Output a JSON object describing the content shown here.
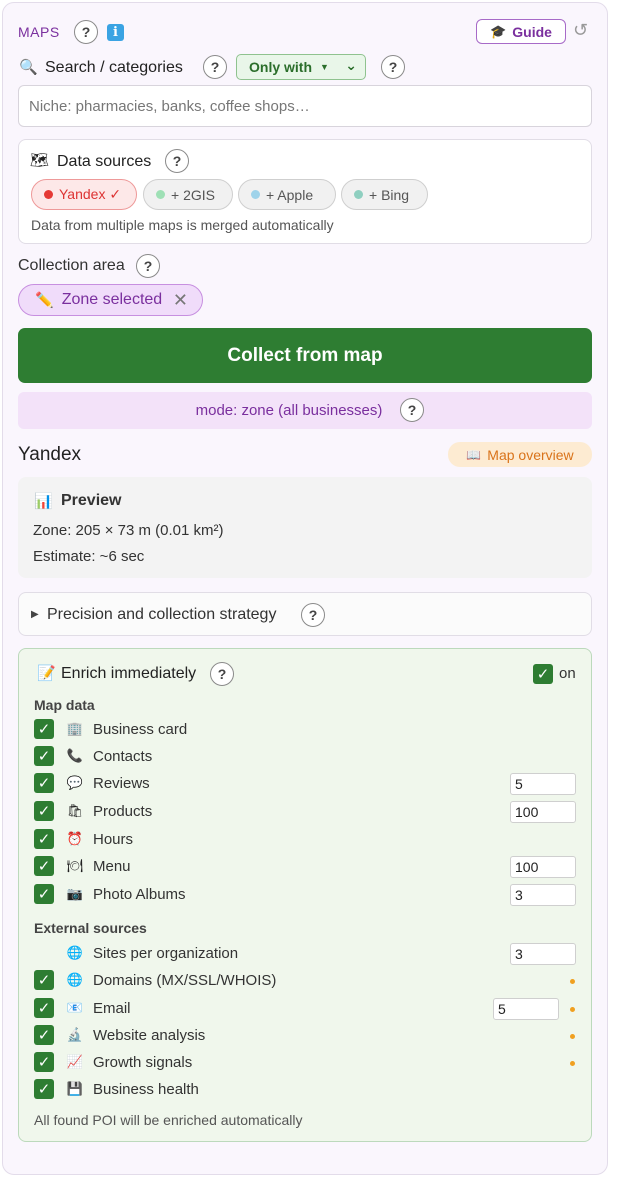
{
  "header": {
    "title": "MAPS",
    "info_glyph": "i",
    "guide_label": "Guide",
    "reset_glyph": "↺"
  },
  "search": {
    "label": "Search / categories",
    "filter_value": "Only with",
    "placeholder": "Niche: pharmacies, banks, coffee shops…"
  },
  "sources": {
    "title": "Data sources",
    "items": [
      {
        "label": "Yandex ✓",
        "color": "#e53935",
        "active": true
      },
      {
        "label": "+ 2GIS",
        "color": "#9ee0b5",
        "active": false
      },
      {
        "label": "+ Apple",
        "color": "#9fd3ea",
        "active": false
      },
      {
        "label": "+ Bing",
        "color": "#8fcfc0",
        "active": false
      }
    ],
    "note": "Data from multiple maps is merged automatically"
  },
  "area": {
    "label": "Collection area",
    "chip": "Zone selected"
  },
  "collect_button": "Collect from map",
  "mode_text": "mode: zone (all businesses)",
  "provider": {
    "name": "Yandex",
    "overview_label": "Map overview"
  },
  "preview": {
    "title": "Preview",
    "zone": "Zone: 205 × 73 m (0.01 km²)",
    "estimate": "Estimate: ~6 sec"
  },
  "precision_label": "Precision and collection strategy",
  "enrich": {
    "title": "Enrich immediately",
    "toggle_label": "on",
    "map_section": "Map data",
    "map_rows": [
      {
        "label": "Business card",
        "icon": "🏢",
        "value": ""
      },
      {
        "label": "Contacts",
        "icon": "📞",
        "value": ""
      },
      {
        "label": "Reviews",
        "icon": "💬",
        "value": "5"
      },
      {
        "label": "Products",
        "icon": "🛍",
        "value": "100"
      },
      {
        "label": "Hours",
        "icon": "⏰",
        "value": ""
      },
      {
        "label": "Menu",
        "icon": "🍽",
        "value": "100"
      },
      {
        "label": "Photo Albums",
        "icon": "📷",
        "value": "3"
      }
    ],
    "ext_section": "External sources",
    "sites_label": "Sites per organization",
    "sites_value": "3",
    "ext_rows": [
      {
        "label": "Domains (MX/SSL/WHOIS)",
        "icon": "🌐"
      },
      {
        "label": "Email",
        "icon": "📧",
        "value": "5"
      },
      {
        "label": "Website analysis",
        "icon": "🔬"
      },
      {
        "label": "Growth signals",
        "icon": "📈"
      },
      {
        "label": "Business health",
        "icon": "💾"
      }
    ],
    "footer": "All found POI will be enriched automatically"
  },
  "colors": {
    "accent_purple": "#7a2f9e",
    "primary_green": "#2e7d32",
    "orange": "#d9731a"
  }
}
